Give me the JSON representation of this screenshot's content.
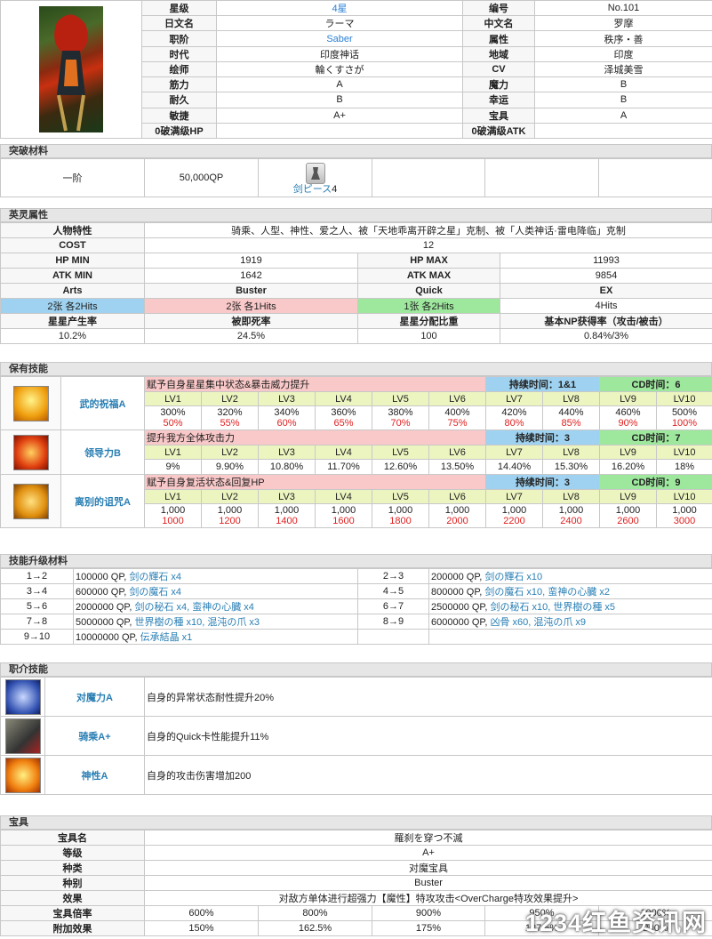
{
  "profile": {
    "rows": [
      [
        "星级",
        "4星",
        "编号",
        "No.101"
      ],
      [
        "日文名",
        "ラーマ",
        "中文名",
        "罗摩"
      ],
      [
        "职阶",
        "Saber",
        "属性",
        "秩序・善"
      ],
      [
        "时代",
        "印度神话",
        "地域",
        "印度"
      ],
      [
        "绘师",
        "輪くすさが",
        "CV",
        "泽城美雪"
      ],
      [
        "筋力",
        "A",
        "魔力",
        "B"
      ],
      [
        "耐久",
        "B",
        "幸运",
        "B"
      ],
      [
        "敏捷",
        "A+",
        "宝具",
        "A"
      ],
      [
        "0破满级HP",
        "",
        "0破满级ATK",
        ""
      ]
    ]
  },
  "ascension": {
    "title": "突破材料",
    "stage": "一阶",
    "qp": "50,000QP",
    "item_label": "剑ピース",
    "item_count": "4"
  },
  "attributes": {
    "title": "英灵属性",
    "trait_label": "人物特性",
    "traits": "骑乘、人型、神性、爱之人、被「天地乖离开辟之星」克制、被「人类神话·雷电降临」克制",
    "cost_label": "COST",
    "cost": "12",
    "hpmin_label": "HP MIN",
    "hpmin": "1919",
    "hpmax_label": "HP MAX",
    "hpmax": "11993",
    "atkmin_label": "ATK MIN",
    "atkmin": "1642",
    "atkmax_label": "ATK MAX",
    "atkmax": "9854",
    "card_headers": [
      "Arts",
      "Buster",
      "Quick",
      "EX"
    ],
    "card_values": [
      "2张 各2Hits",
      "2张 各1Hits",
      "1张 各2Hits",
      "4Hits"
    ],
    "misc_headers": [
      "星星产生率",
      "被即死率",
      "星星分配比重",
      "基本NP获得率（攻击/被击）"
    ],
    "misc_values": [
      "10.2%",
      "24.5%",
      "100",
      "0.84%/3%"
    ]
  },
  "skills": {
    "title": "保有技能",
    "lv_labels": [
      "LV1",
      "LV2",
      "LV3",
      "LV4",
      "LV5",
      "LV6",
      "LV7",
      "LV8",
      "LV9",
      "LV10"
    ],
    "list": [
      {
        "name": "武的祝福A",
        "desc": "赋予自身星星集中状态&暴击威力提升",
        "duration": "持续时间：1&1",
        "cd": "CD时间：6",
        "v1": [
          "300%",
          "320%",
          "340%",
          "360%",
          "380%",
          "400%",
          "420%",
          "440%",
          "460%",
          "500%"
        ],
        "v2": [
          "50%",
          "55%",
          "60%",
          "65%",
          "70%",
          "75%",
          "80%",
          "85%",
          "90%",
          "100%"
        ]
      },
      {
        "name": "领导力B",
        "desc": "提升我方全体攻击力",
        "duration": "持续时间：3",
        "cd": "CD时间：7",
        "v1": [
          "9%",
          "9.90%",
          "10.80%",
          "11.70%",
          "12.60%",
          "13.50%",
          "14.40%",
          "15.30%",
          "16.20%",
          "18%"
        ],
        "v2": []
      },
      {
        "name": "离别的诅咒A",
        "desc": "赋予自身复活状态&回复HP",
        "duration": "持续时间：3",
        "cd": "CD时间：9",
        "v1": [
          "1,000",
          "1,000",
          "1,000",
          "1,000",
          "1,000",
          "1,000",
          "1,000",
          "1,000",
          "1,000",
          "1,000"
        ],
        "v2": [
          "1000",
          "1200",
          "1400",
          "1600",
          "1800",
          "2000",
          "2200",
          "2400",
          "2600",
          "3000"
        ]
      }
    ]
  },
  "upgrade": {
    "title": "技能升级材料",
    "rows": [
      {
        "l": "1→2",
        "lq": "100000 QP, ",
        "li": "剑の輝石 x4",
        "r": "2→3",
        "rq": "200000 QP, ",
        "ri": "剑の輝石 x10"
      },
      {
        "l": "3→4",
        "lq": "600000 QP, ",
        "li": "剑の魔石 x4",
        "r": "4→5",
        "rq": "800000 QP, ",
        "ri": "剑の魔石 x10, 蛮神の心臓 x2"
      },
      {
        "l": "5→6",
        "lq": "2000000 QP, ",
        "li": "剑の秘石 x4, 蛮神の心臓 x4",
        "r": "6→7",
        "rq": "2500000 QP, ",
        "ri": "剑の秘石 x10, 世界樹の種 x5"
      },
      {
        "l": "7→8",
        "lq": "5000000 QP, ",
        "li": "世界樹の種 x10, 混沌の爪 x3",
        "r": "8→9",
        "rq": "6000000 QP, ",
        "ri": "凶骨 x60, 混沌の爪 x9"
      },
      {
        "l": "9→10",
        "lq": "10000000 QP, ",
        "li": "伝承結晶 x1",
        "r": "",
        "rq": "",
        "ri": ""
      }
    ]
  },
  "class_skills": {
    "title": "职介技能",
    "list": [
      {
        "name": "对魔力A",
        "desc": "自身的异常状态耐性提升20%"
      },
      {
        "name": "骑乘A+",
        "desc": "自身的Quick卡性能提升11%"
      },
      {
        "name": "神性A",
        "desc": "自身的攻击伤害增加200"
      }
    ]
  },
  "np": {
    "title": "宝具",
    "rows": [
      [
        "宝具名",
        "羅刹を穿つ不滅"
      ],
      [
        "等级",
        "A+"
      ],
      [
        "种类",
        "对魔宝具"
      ],
      [
        "种别",
        "Buster"
      ],
      [
        "效果",
        "对敌方单体进行超强力【魔性】特攻攻击<OverCharge特攻效果提升>"
      ]
    ],
    "mult_label": "宝具倍率",
    "mult": [
      "600%",
      "800%",
      "900%",
      "950%",
      "1000%"
    ],
    "extra_label": "附加效果",
    "extra": [
      "150%",
      "162.5%",
      "175%",
      "187.5%",
      "200%"
    ]
  },
  "watermark": "1234红鱼资讯网",
  "colors": {
    "accent": "#2a7fd4",
    "red": "#e02020",
    "pink": "#f9c8c8",
    "lblue": "#9fd2f0",
    "lgreen": "#9ee89e"
  }
}
